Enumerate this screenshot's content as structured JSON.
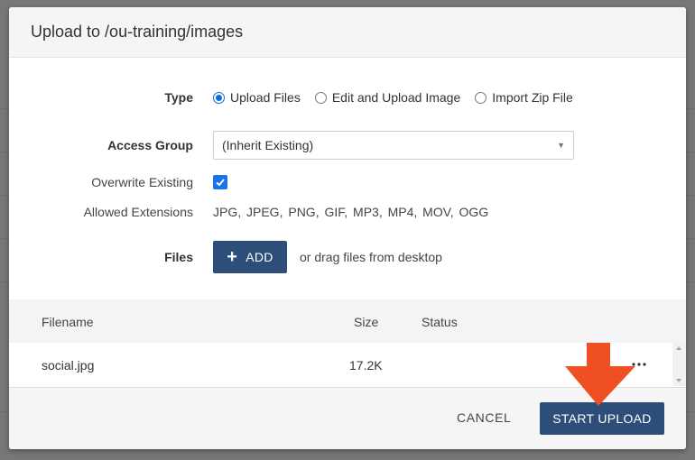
{
  "dialog": {
    "title": "Upload to /ou-training/images"
  },
  "form": {
    "type_label": "Type",
    "type_options": [
      {
        "label": "Upload Files",
        "selected": true
      },
      {
        "label": "Edit and Upload Image",
        "selected": false
      },
      {
        "label": "Import Zip File",
        "selected": false
      }
    ],
    "access_group_label": "Access Group",
    "access_group_value": "(Inherit Existing)",
    "overwrite_label": "Overwrite Existing",
    "overwrite_checked": true,
    "allowed_ext_label": "Allowed Extensions",
    "allowed_ext_value": "JPG,  JPEG,  PNG,  GIF,  MP3,  MP4,  MOV,  OGG",
    "files_label": "Files",
    "add_button": "ADD",
    "drag_text": "or drag files from desktop"
  },
  "table": {
    "columns": [
      "Filename",
      "Size",
      "Status"
    ],
    "rows": [
      {
        "filename": "social.jpg",
        "size": "17.2K",
        "status": ""
      }
    ]
  },
  "footer": {
    "cancel": "CANCEL",
    "start_upload": "START UPLOAD"
  },
  "colors": {
    "primary_button": "#2d4e78",
    "radio_accent": "#0b6fd6",
    "checkbox": "#1a73e8",
    "annotation_arrow": "#f04e23"
  },
  "icons": {
    "add": "plus-icon",
    "row_menu": "more-horizontal-icon",
    "select": "chevron-down-icon",
    "annotation": "arrow-down-icon"
  }
}
